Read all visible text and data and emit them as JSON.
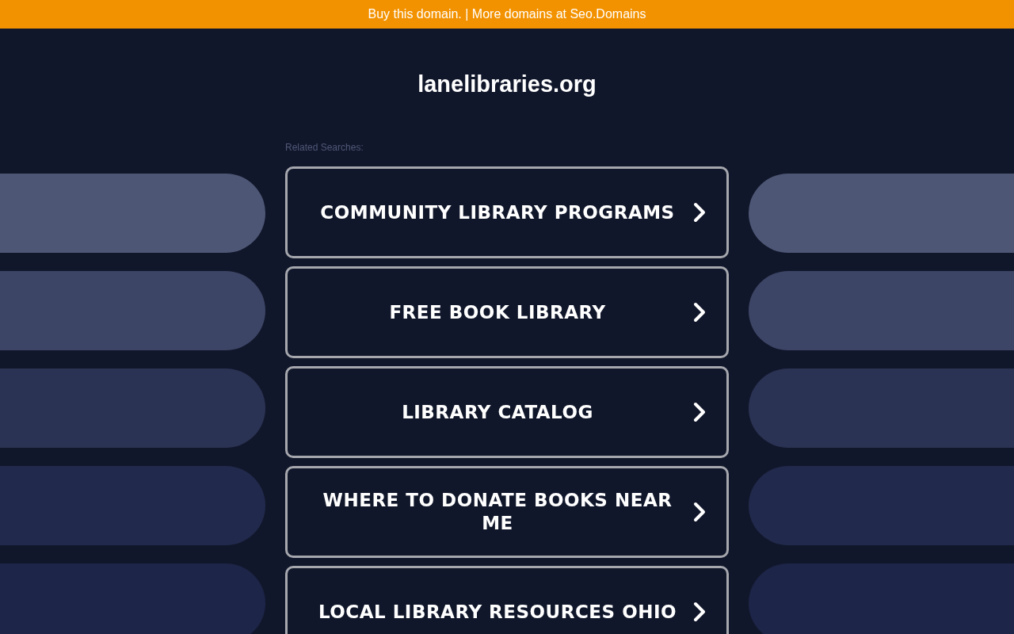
{
  "top_bar": {
    "text": "Buy this domain. | More domains at Seo.Domains"
  },
  "domain": "lanelibraries.org",
  "related_label": "Related Searches:",
  "searches": [
    {
      "label": "COMMUNITY LIBRARY PROGRAMS"
    },
    {
      "label": "FREE BOOK LIBRARY"
    },
    {
      "label": "LIBRARY CATALOG"
    },
    {
      "label": "WHERE TO DONATE BOOKS NEAR ME"
    },
    {
      "label": "LOCAL LIBRARY RESOURCES OHIO"
    }
  ]
}
